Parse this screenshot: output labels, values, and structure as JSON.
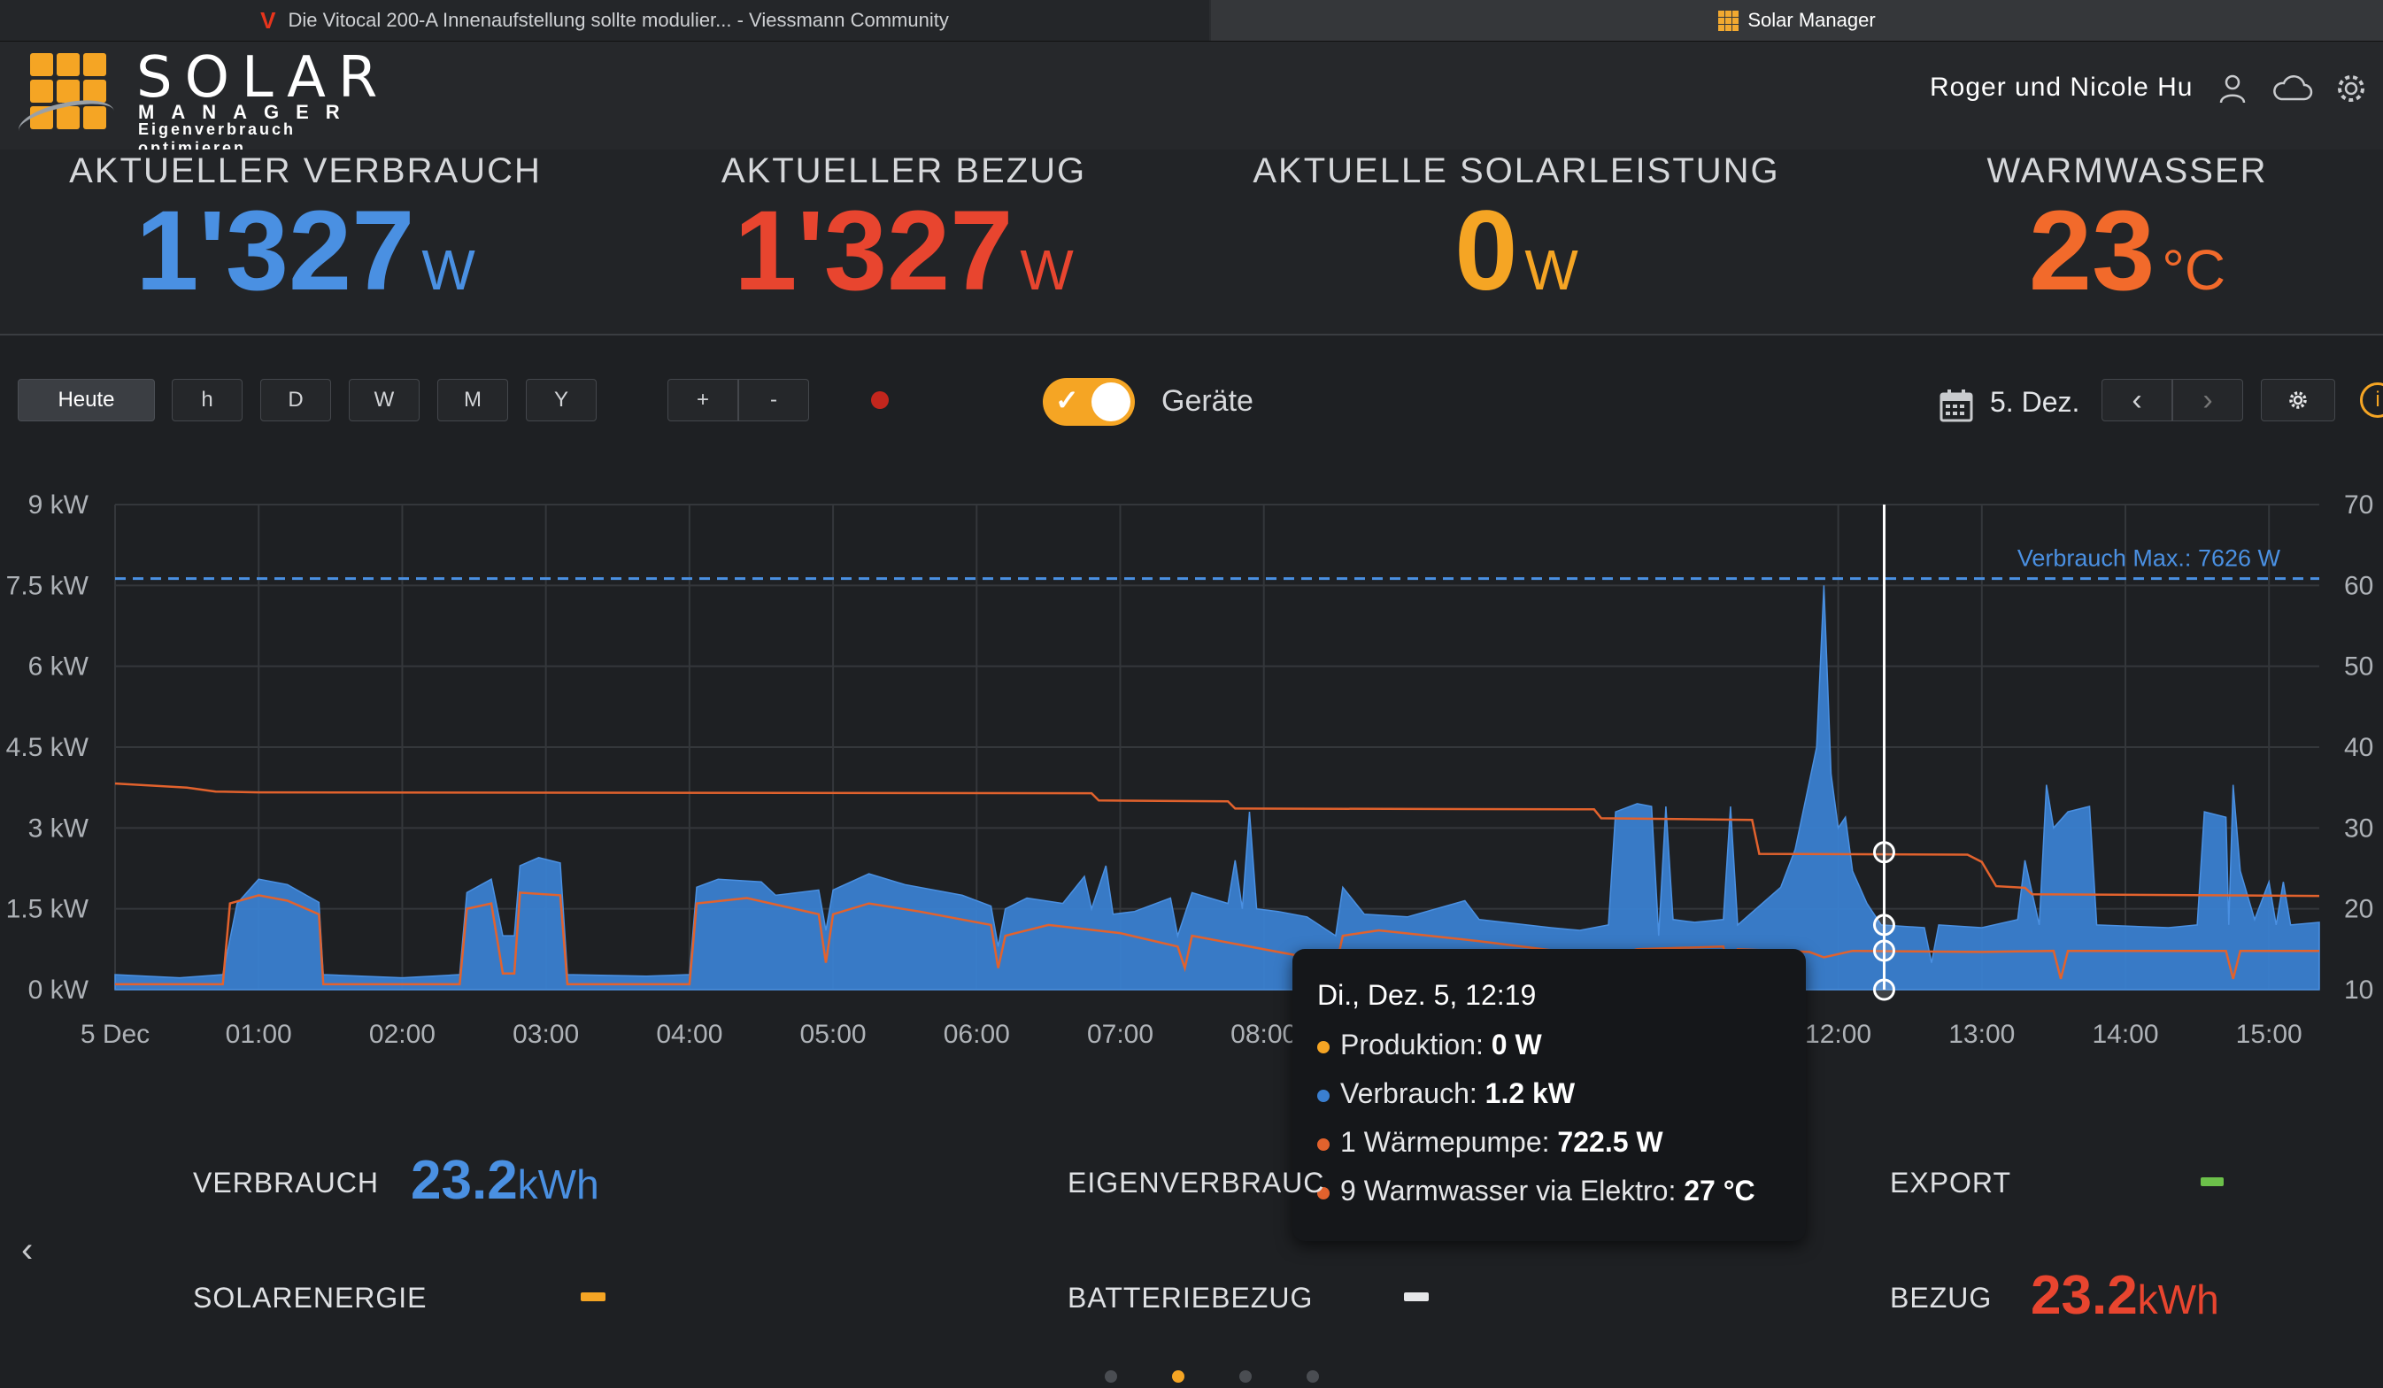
{
  "browser": {
    "tabs": [
      {
        "title": "Die Vitocal 200-A Innenaufstellung sollte modulier... - Viessmann Community",
        "icon": "viessmann-v-icon",
        "active": false
      },
      {
        "title": "Solar Manager",
        "icon": "solar-manager-icon",
        "active": true
      }
    ]
  },
  "header": {
    "logo_word": "SOLAR",
    "logo_sub": "MANAGER",
    "logo_tagline": "Eigenverbrauch optimieren",
    "user": "Roger und Nicole Hu",
    "icons": [
      "user-icon",
      "cloud-icon",
      "gear-icon"
    ]
  },
  "kpis": [
    {
      "label": "AKTUELLER VERBRAUCH",
      "value": "1'327",
      "unit": "W",
      "color": "#4a90e2"
    },
    {
      "label": "AKTUELLER BEZUG",
      "value": "1'327",
      "unit": "W",
      "color": "#e8452f"
    },
    {
      "label": "AKTUELLE SOLARLEISTUNG",
      "value": "0",
      "unit": "W",
      "color": "#f5a524"
    },
    {
      "label": "WARMWASSER",
      "value": "23",
      "unit": "°C",
      "color": "#f26a2b"
    }
  ],
  "controls": {
    "periods": [
      "Heute",
      "h",
      "D",
      "W",
      "M",
      "Y"
    ],
    "zoom": [
      "+",
      "-"
    ],
    "toggle_label": "Geräte",
    "toggle_on": true,
    "date": "5. Dez.",
    "prev": "‹",
    "next": "›"
  },
  "chart_data": {
    "type": "area",
    "x_ticks": [
      "5 Dec",
      "01:00",
      "02:00",
      "03:00",
      "04:00",
      "05:00",
      "06:00",
      "07:00",
      "08:00",
      "12:00",
      "13:00",
      "14:00",
      "15:00"
    ],
    "y_left_ticks": [
      "0 kW",
      "1.5 kW",
      "3 kW",
      "4.5 kW",
      "6 kW",
      "7.5 kW",
      "9 kW"
    ],
    "y_left_range": [
      0,
      9
    ],
    "y_right_ticks": [
      "10",
      "20",
      "30",
      "40",
      "50",
      "60",
      "70"
    ],
    "y_right_range": [
      10,
      70
    ],
    "reference_line": {
      "label": "Verbrauch Max.: 7626 W",
      "value": 7.626
    },
    "cursor_time": 12.32,
    "series": [
      {
        "name": "Verbrauch",
        "unit": "kW",
        "color": "#3a7fd0",
        "points": [
          [
            0,
            0.28
          ],
          [
            0.45,
            0.22
          ],
          [
            0.75,
            0.28
          ],
          [
            0.85,
            1.6
          ],
          [
            1.0,
            2.05
          ],
          [
            1.2,
            1.95
          ],
          [
            1.42,
            1.62
          ],
          [
            1.45,
            0.28
          ],
          [
            2.0,
            0.22
          ],
          [
            2.4,
            0.28
          ],
          [
            2.45,
            1.8
          ],
          [
            2.62,
            2.05
          ],
          [
            2.7,
            1.0
          ],
          [
            2.78,
            1.0
          ],
          [
            2.82,
            2.3
          ],
          [
            2.95,
            2.45
          ],
          [
            3.1,
            2.35
          ],
          [
            3.15,
            0.28
          ],
          [
            3.7,
            0.25
          ],
          [
            4.0,
            0.28
          ],
          [
            4.05,
            1.9
          ],
          [
            4.2,
            2.05
          ],
          [
            4.5,
            2.0
          ],
          [
            4.6,
            1.75
          ],
          [
            4.9,
            1.85
          ],
          [
            4.95,
            1.1
          ],
          [
            5.0,
            1.85
          ],
          [
            5.25,
            2.15
          ],
          [
            5.5,
            1.95
          ],
          [
            5.9,
            1.75
          ],
          [
            6.1,
            1.55
          ],
          [
            6.15,
            0.8
          ],
          [
            6.2,
            1.5
          ],
          [
            6.35,
            1.7
          ],
          [
            6.6,
            1.6
          ],
          [
            6.75,
            2.1
          ],
          [
            6.8,
            1.5
          ],
          [
            6.9,
            2.3
          ],
          [
            6.95,
            1.4
          ],
          [
            7.1,
            1.45
          ],
          [
            7.35,
            1.7
          ],
          [
            7.4,
            1.0
          ],
          [
            7.5,
            1.8
          ],
          [
            7.75,
            1.6
          ],
          [
            7.8,
            2.4
          ],
          [
            7.85,
            1.5
          ],
          [
            7.9,
            3.3
          ],
          [
            7.95,
            1.5
          ],
          [
            8.1,
            1.45
          ],
          [
            8.3,
            1.35
          ],
          [
            8.5,
            1.0
          ],
          [
            8.55,
            1.9
          ],
          [
            8.7,
            1.4
          ],
          [
            9.0,
            1.35
          ],
          [
            9.4,
            1.65
          ],
          [
            9.5,
            1.3
          ],
          [
            10.0,
            1.15
          ],
          [
            10.2,
            1.1
          ],
          [
            10.4,
            1.2
          ],
          [
            10.45,
            3.3
          ],
          [
            10.6,
            3.45
          ],
          [
            10.7,
            3.4
          ],
          [
            10.75,
            1.0
          ],
          [
            10.8,
            3.4
          ],
          [
            10.85,
            1.3
          ],
          [
            11.0,
            1.25
          ],
          [
            11.2,
            1.3
          ],
          [
            11.25,
            3.4
          ],
          [
            11.3,
            1.2
          ],
          [
            11.6,
            1.9
          ],
          [
            11.7,
            2.6
          ],
          [
            11.85,
            4.5
          ],
          [
            11.9,
            7.5
          ],
          [
            11.95,
            4.0
          ],
          [
            12.0,
            3.0
          ],
          [
            12.05,
            3.2
          ],
          [
            12.1,
            2.2
          ],
          [
            12.2,
            1.6
          ],
          [
            12.3,
            1.2
          ],
          [
            12.6,
            1.15
          ],
          [
            12.65,
            0.5
          ],
          [
            12.7,
            1.2
          ],
          [
            13.0,
            1.15
          ],
          [
            13.25,
            1.3
          ],
          [
            13.3,
            2.4
          ],
          [
            13.4,
            1.2
          ],
          [
            13.45,
            3.8
          ],
          [
            13.5,
            3.0
          ],
          [
            13.6,
            3.3
          ],
          [
            13.75,
            3.4
          ],
          [
            13.8,
            1.2
          ],
          [
            14.3,
            1.15
          ],
          [
            14.5,
            1.2
          ],
          [
            14.55,
            3.3
          ],
          [
            14.7,
            3.2
          ],
          [
            14.72,
            1.2
          ],
          [
            14.75,
            3.8
          ],
          [
            14.8,
            2.2
          ],
          [
            14.9,
            1.3
          ],
          [
            15.0,
            2.0
          ],
          [
            15.05,
            1.2
          ],
          [
            15.1,
            2.0
          ],
          [
            15.15,
            1.2
          ],
          [
            15.35,
            1.25
          ]
        ]
      },
      {
        "name": "1 Wärmepumpe",
        "unit": "kW",
        "color": "#e2622d",
        "points": [
          [
            0,
            0.1
          ],
          [
            0.75,
            0.1
          ],
          [
            0.8,
            1.6
          ],
          [
            1.0,
            1.75
          ],
          [
            1.2,
            1.65
          ],
          [
            1.42,
            1.4
          ],
          [
            1.45,
            0.1
          ],
          [
            2.4,
            0.1
          ],
          [
            2.45,
            1.5
          ],
          [
            2.62,
            1.6
          ],
          [
            2.7,
            0.3
          ],
          [
            2.78,
            0.3
          ],
          [
            2.82,
            1.8
          ],
          [
            3.1,
            1.75
          ],
          [
            3.15,
            0.1
          ],
          [
            4.0,
            0.1
          ],
          [
            4.05,
            1.6
          ],
          [
            4.4,
            1.7
          ],
          [
            4.9,
            1.4
          ],
          [
            4.95,
            0.5
          ],
          [
            5.0,
            1.4
          ],
          [
            5.25,
            1.6
          ],
          [
            5.6,
            1.45
          ],
          [
            6.1,
            1.2
          ],
          [
            6.15,
            0.4
          ],
          [
            6.2,
            1.0
          ],
          [
            6.5,
            1.2
          ],
          [
            7.0,
            1.05
          ],
          [
            7.4,
            0.8
          ],
          [
            7.45,
            0.4
          ],
          [
            7.5,
            1.0
          ],
          [
            8.3,
            0.6
          ],
          [
            8.5,
            0.4
          ],
          [
            8.55,
            1.0
          ],
          [
            8.8,
            1.1
          ],
          [
            9.5,
            0.9
          ],
          [
            10.4,
            0.6
          ],
          [
            10.6,
            0.75
          ],
          [
            11.2,
            0.8
          ],
          [
            11.25,
            0.2
          ],
          [
            11.3,
            0.75
          ],
          [
            11.8,
            0.7
          ],
          [
            11.9,
            0.6
          ],
          [
            12.1,
            0.72
          ],
          [
            13.0,
            0.7
          ],
          [
            13.5,
            0.72
          ],
          [
            13.55,
            0.2
          ],
          [
            13.6,
            0.72
          ],
          [
            14.7,
            0.72
          ],
          [
            14.75,
            0.2
          ],
          [
            14.8,
            0.72
          ],
          [
            15.35,
            0.72
          ]
        ]
      },
      {
        "name": "9 Warmwasser via Elektro",
        "unit": "°C",
        "color": "#e2622d",
        "points": [
          [
            0,
            35.5
          ],
          [
            0.5,
            35.0
          ],
          [
            0.7,
            34.5
          ],
          [
            1.0,
            34.4
          ],
          [
            6.8,
            34.3
          ],
          [
            6.85,
            33.4
          ],
          [
            7.75,
            33.3
          ],
          [
            7.8,
            32.4
          ],
          [
            10.3,
            32.3
          ],
          [
            10.35,
            31.2
          ],
          [
            11.4,
            31.0
          ],
          [
            11.45,
            26.8
          ],
          [
            12.9,
            26.7
          ],
          [
            13.0,
            25.8
          ],
          [
            13.1,
            22.8
          ],
          [
            13.3,
            22.6
          ],
          [
            13.35,
            21.8
          ],
          [
            15.35,
            21.6
          ]
        ]
      }
    ]
  },
  "tooltip": {
    "title": "Di., Dez. 5, 12:19",
    "rows": [
      {
        "label": "Produktion:",
        "value": "0 W",
        "color": "#f5a524"
      },
      {
        "label": "Verbrauch:",
        "value": "1.2 kW",
        "color": "#3a7fd0"
      },
      {
        "label": "1 Wärmepumpe:",
        "value": "722.5 W",
        "color": "#e2622d"
      },
      {
        "label": "9 Warmwasser via Elektro:",
        "value": "27 °C",
        "color": "#e2622d"
      }
    ]
  },
  "summary": {
    "verbrauch": {
      "label": "VERBRAUCH",
      "value": "23.2",
      "unit": "kWh",
      "color": "#4a90e2"
    },
    "eigenverbrauch": {
      "label": "EIGENVERBRAUC"
    },
    "export": {
      "label": "EXPORT",
      "dash_color": "#6cc04a"
    },
    "solarenergie": {
      "label": "SOLARENERGIE",
      "dash_color": "#f5a524"
    },
    "batteriebezug": {
      "label": "BATTERIEBEZUG",
      "dash_color": "#e6e7e9"
    },
    "bezug": {
      "label": "BEZUG",
      "value": "23.2",
      "unit": "kWh",
      "color": "#e8452f"
    }
  },
  "pagination": {
    "count": 4,
    "active": 1
  }
}
